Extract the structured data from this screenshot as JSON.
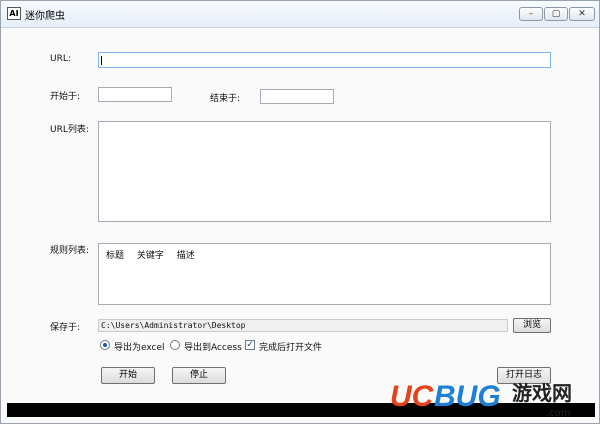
{
  "window": {
    "title": "迷你爬虫",
    "app_icon_text": "AI",
    "controls": {
      "minimize": "–",
      "maximize": "▢",
      "close": "✕"
    }
  },
  "form": {
    "url_label": "URL:",
    "url_value": "",
    "start_label": "开始于:",
    "start_value": "",
    "end_label": "结束于:",
    "end_value": "",
    "url_list_label": "URL列表:",
    "rules_label": "规则列表:",
    "rules_columns": [
      "标题",
      "关键字",
      "描述"
    ],
    "save_label": "保存于:",
    "save_path": "C:\\Users\\Administrator\\Desktop",
    "browse_button": "浏览",
    "export_excel": "导出为excel",
    "export_access": "导出到Access",
    "open_after": "完成后打开文件",
    "export_selected": "excel",
    "open_after_checked": true
  },
  "actions": {
    "start_button": "开始",
    "stop_button": "停止",
    "open_log_button": "打开日志"
  },
  "watermark": {
    "brand": "UCBUG",
    "brand_suffix": "游戏网",
    "domain": ".com",
    "colors": {
      "uc": "#e8421b",
      "bug": "#1e7fd6",
      "text": "#222222"
    }
  }
}
